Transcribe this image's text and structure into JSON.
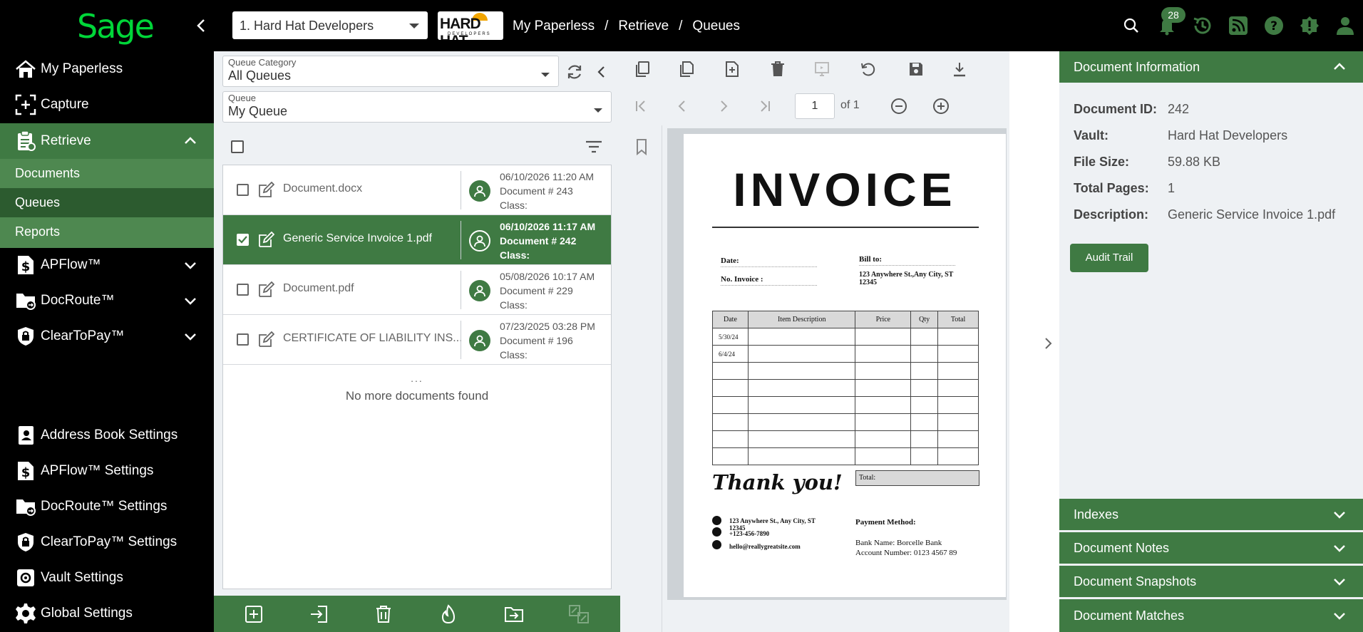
{
  "topbar": {
    "logo": "Sage",
    "company_selected": "1. Hard Hat Developers",
    "company_logo_text": "HARD HAT",
    "company_logo_sub": "DEVELOPERS",
    "breadcrumb": [
      "My Paperless",
      "/",
      "Retrieve",
      "/",
      "Queues"
    ],
    "notification_count": "28",
    "icons": [
      "search-icon",
      "bell-icon",
      "history-icon",
      "rss-icon",
      "help-icon",
      "alert-badge-icon",
      "user-icon"
    ]
  },
  "nav": {
    "my_paperless": "My Paperless",
    "capture": "Capture",
    "retrieve": "Retrieve",
    "documents": "Documents",
    "queues": "Queues",
    "reports": "Reports",
    "apflow": "APFlow™",
    "docroute": "DocRoute™",
    "cleartopay": "ClearToPay™",
    "address_book_settings": "Address Book Settings",
    "apflow_settings": "APFlow™ Settings",
    "docroute_settings": "DocRoute™ Settings",
    "cleartopay_settings": "ClearToPay™ Settings",
    "vault_settings": "Vault Settings",
    "global_settings": "Global Settings"
  },
  "queue": {
    "category_label": "Queue Category",
    "category_value": "All Queues",
    "queue_label": "Queue",
    "queue_value": "My Queue",
    "docs": [
      {
        "name": "Document.docx",
        "date": "06/10/2026 11:20 AM",
        "docnum": "Document # 243",
        "cls": "Class:"
      },
      {
        "name": "Generic Service Invoice 1.pdf",
        "date": "06/10/2026 11:17 AM",
        "docnum": "Document # 242",
        "cls": "Class:"
      },
      {
        "name": "Document.pdf",
        "date": "05/08/2026 10:17 AM",
        "docnum": "Document # 229",
        "cls": "Class:"
      },
      {
        "name": "CERTIFICATE OF LIABILITY INS...",
        "date": "07/23/2025 03:28 PM",
        "docnum": "Document # 196",
        "cls": "Class:"
      }
    ],
    "dots": "...",
    "no_more": "No more documents found"
  },
  "viewer": {
    "page": "1",
    "of_pages": "of 1"
  },
  "invoice": {
    "title": "INVOICE",
    "date_lbl": "Date:",
    "invno_lbl": "No. Invoice :",
    "billto_lbl": "Bill to:",
    "billto_addr1": "123 Anywhere St.,Any City, ST",
    "billto_addr2": "12345",
    "th_date": "Date",
    "th_desc": "Item Description",
    "th_price": "Price",
    "th_qty": "Qty",
    "th_total": "Total",
    "row1_date": "5/30/24",
    "row2_date": "6/4/24",
    "total_lbl": "Total:",
    "thanks": "Thank you!",
    "addr1": "123 Anywhere St., Any City, ST",
    "addr2": "12345",
    "phone": "+123-456-7890",
    "email": "hello@reallygreatsite.com",
    "pay_head": "Payment Method:",
    "bank": "Bank Name: Borcelle Bank",
    "account": "Account Number: 0123 4567 89"
  },
  "info": {
    "header": "Document Information",
    "id_k": "Document ID:",
    "id_v": "242",
    "vault_k": "Vault:",
    "vault_v": "Hard Hat Developers",
    "size_k": "File Size:",
    "size_v": "59.88 KB",
    "pages_k": "Total Pages:",
    "pages_v": "1",
    "desc_k": "Description:",
    "desc_v": "Generic Service Invoice 1.pdf",
    "audit": "Audit Trail",
    "indexes": "Indexes",
    "notes": "Document Notes",
    "snapshots": "Document Snapshots",
    "matches": "Document Matches"
  },
  "colors": {
    "brand_green": "#3f7a43",
    "logo_green": "#00d639",
    "nav_selected": "#2c5b2f"
  }
}
